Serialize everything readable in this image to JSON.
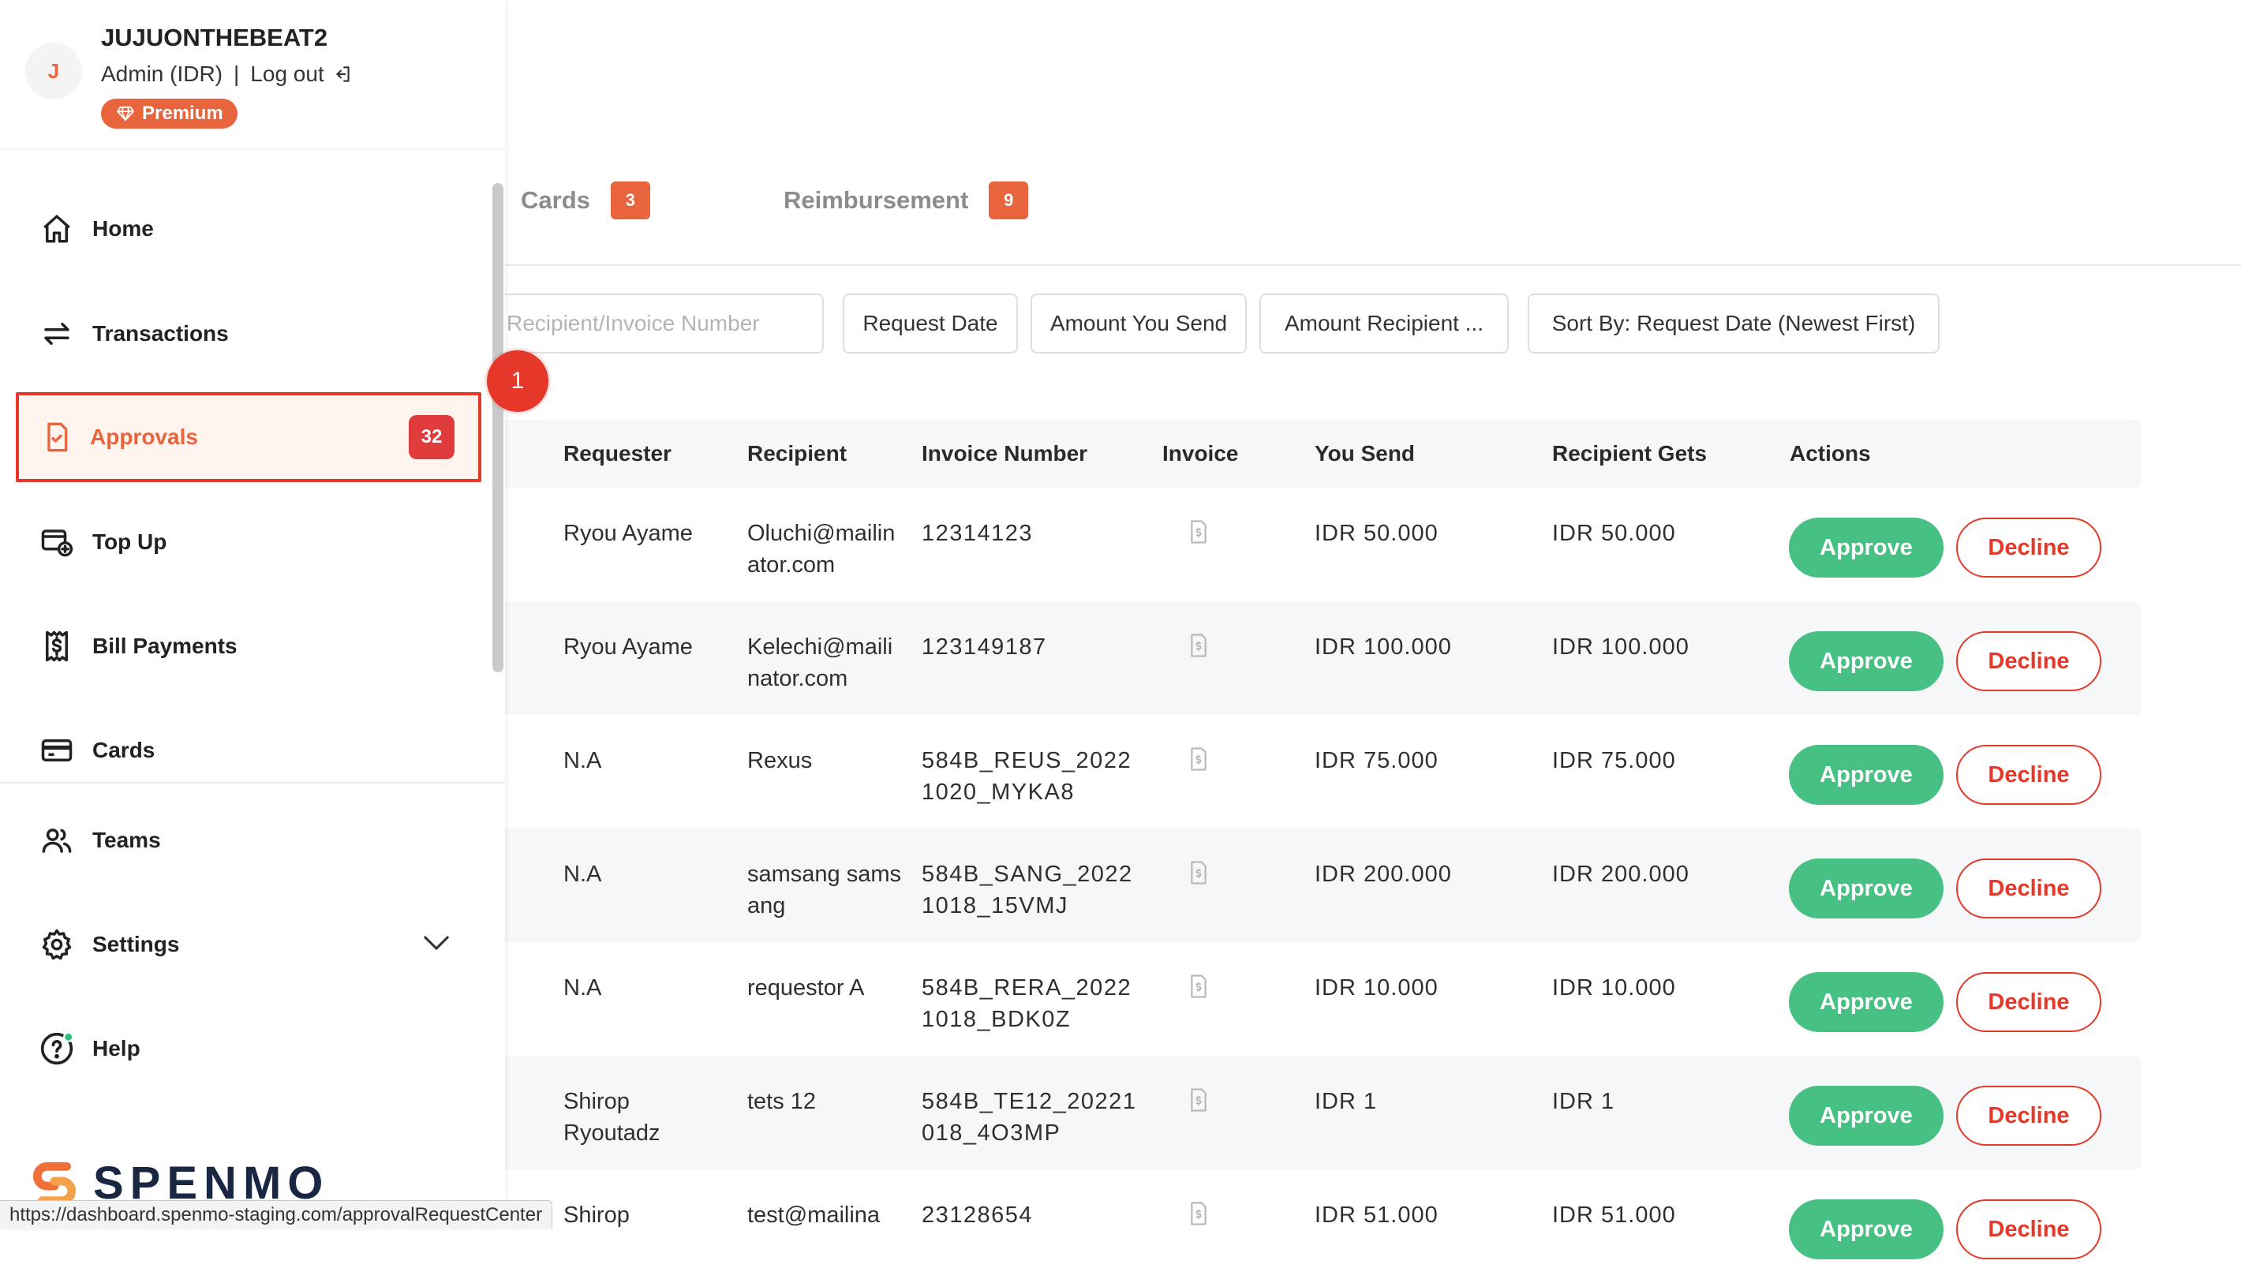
{
  "profile": {
    "avatar_initial": "J",
    "username": "JUJUONTHEBEAT2",
    "role": "Admin (IDR)",
    "separator": "|",
    "logout_label": "Log out",
    "badge": "Premium"
  },
  "sidebar": {
    "items": [
      {
        "label": "Home",
        "icon": "home-icon"
      },
      {
        "label": "Transactions",
        "icon": "transfer-arrows-icon"
      },
      {
        "label": "Approvals",
        "icon": "approval-document-icon",
        "badge": "32",
        "active": true
      },
      {
        "label": "Top Up",
        "icon": "wallet-plus-icon"
      },
      {
        "label": "Bill Payments",
        "icon": "bill-dollar-icon"
      },
      {
        "label": "Cards",
        "icon": "credit-card-icon"
      },
      {
        "label": "Teams",
        "icon": "people-icon"
      },
      {
        "label": "Settings",
        "icon": "gear-icon"
      },
      {
        "label": "Help",
        "icon": "help-icon"
      }
    ]
  },
  "brand": {
    "name": "SPENMO"
  },
  "tabs": [
    {
      "label": "Cards",
      "count": "3"
    },
    {
      "label": "Reimbursement",
      "count": "9"
    }
  ],
  "filters": {
    "search_placeholder": "Recipient/Invoice Number",
    "request_date": "Request Date",
    "amount_you_send": "Amount You Send",
    "amount_recipient": "Amount Recipient ...",
    "sort_by": "Sort By: Request Date (Newest First)"
  },
  "step_marker": "1",
  "table": {
    "headers": {
      "requester": "Requester",
      "recipient": "Recipient",
      "invoice_number": "Invoice Number",
      "invoice": "Invoice",
      "you_send": "You Send",
      "recipient_gets": "Recipient Gets",
      "actions": "Actions"
    },
    "approve_label": "Approve",
    "decline_label": "Decline",
    "rows": [
      {
        "requester": "Ryou Ayame",
        "recipient": "Oluchi@mailinator.com",
        "invoice_number": "12314123",
        "you_send": "IDR 50.000",
        "recipient_gets": "IDR 50.000"
      },
      {
        "requester": "Ryou Ayame",
        "recipient": "Kelechi@mailinator.com",
        "invoice_number": "123149187",
        "you_send": "IDR 100.000",
        "recipient_gets": "IDR 100.000"
      },
      {
        "requester": "N.A",
        "recipient": "Rexus",
        "invoice_number": "584B_REUS_20221020_MYKA8",
        "you_send": "IDR 75.000",
        "recipient_gets": "IDR 75.000"
      },
      {
        "requester": "N.A",
        "recipient": "samsang samsang",
        "invoice_number": "584B_SANG_20221018_15VMJ",
        "you_send": "IDR 200.000",
        "recipient_gets": "IDR 200.000"
      },
      {
        "requester": "N.A",
        "recipient": "requestor A",
        "invoice_number": "584B_RERA_20221018_BDK0Z",
        "you_send": "IDR 10.000",
        "recipient_gets": "IDR 10.000"
      },
      {
        "requester": "Shirop Ryoutadz",
        "recipient": "tets 12",
        "invoice_number": "584B_TE12_20221018_4O3MP",
        "you_send": "IDR 1",
        "recipient_gets": "IDR 1"
      },
      {
        "requester": "Shirop",
        "recipient": "test@mailina",
        "invoice_number": "23128654",
        "you_send": "IDR 51.000",
        "recipient_gets": "IDR 51.000"
      }
    ]
  },
  "status_bar": {
    "url": "https://dashboard.spenmo-staging.com/approvalRequestCenter"
  },
  "colors": {
    "accent": "#e8643c",
    "danger": "#e5372a",
    "success": "#47c084",
    "brand_navy": "#1a2742"
  }
}
